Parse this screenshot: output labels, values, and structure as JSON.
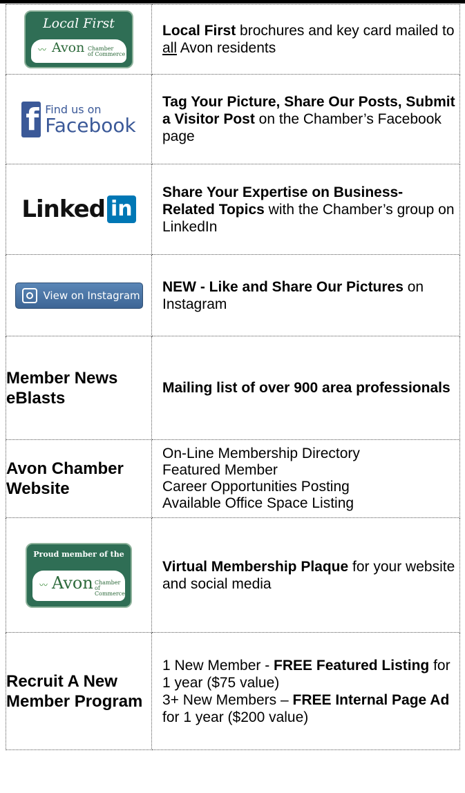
{
  "rows": [
    {
      "logo": {
        "type": "local-first",
        "title": "Local First",
        "seal_word": "Avon",
        "seal_sub1": "Chamber",
        "seal_sub2": "of Commerce"
      },
      "text": {
        "b1": "Local First",
        "t1": " brochures and key card mailed to ",
        "u1": "all",
        "t2": " Avon residents"
      }
    },
    {
      "logo": {
        "type": "facebook",
        "glyph": "f",
        "small": "Find us on",
        "large": "Facebook"
      },
      "text": {
        "b1": "Tag Your Picture, Share Our Posts, Submit a Visitor Post",
        "t1": " on the Chamber’s Facebook page"
      }
    },
    {
      "logo": {
        "type": "linkedin",
        "word": "Linked",
        "badge": "in"
      },
      "text": {
        "b1": "Share Your Expertise on Business-Related Topics",
        "t1": " with the Chamber’s group on LinkedIn"
      }
    },
    {
      "logo": {
        "type": "instagram",
        "label": "View on Instagram"
      },
      "text": {
        "b1": "NEW - Like and Share Our Pictures",
        "t1": " on Instagram"
      }
    },
    {
      "left_heading": "Member News eBlasts",
      "text": {
        "b1": "Mailing list of over 900 area professionals"
      }
    },
    {
      "left_heading": "Avon Chamber Website",
      "lines": [
        "On-Line Membership Directory",
        "Featured Member",
        "Career Opportunities Posting",
        "Available Office Space Listing"
      ]
    },
    {
      "logo": {
        "type": "plaque",
        "title": "Proud member of the",
        "seal_word": "Avon",
        "seal_sub1": "Chamber",
        "seal_sub2": "of Commerce"
      },
      "text": {
        "b1": "Virtual Membership Plaque",
        "t1": " for your website and social media"
      }
    },
    {
      "left_heading": "Recruit A New Member Program",
      "recruit": {
        "a1": "1 New Member - ",
        "a2": "FREE Featured Listing",
        "a3": " for 1 year ($75 value)",
        "b1": "3+ New Members – ",
        "b2": "FREE Internal Page Ad",
        "b3": " for 1 year ($200 value)"
      }
    }
  ],
  "colors": {
    "facebook": "#3b5998",
    "linkedin": "#0077b5",
    "chamber_green": "#2f6e55"
  }
}
